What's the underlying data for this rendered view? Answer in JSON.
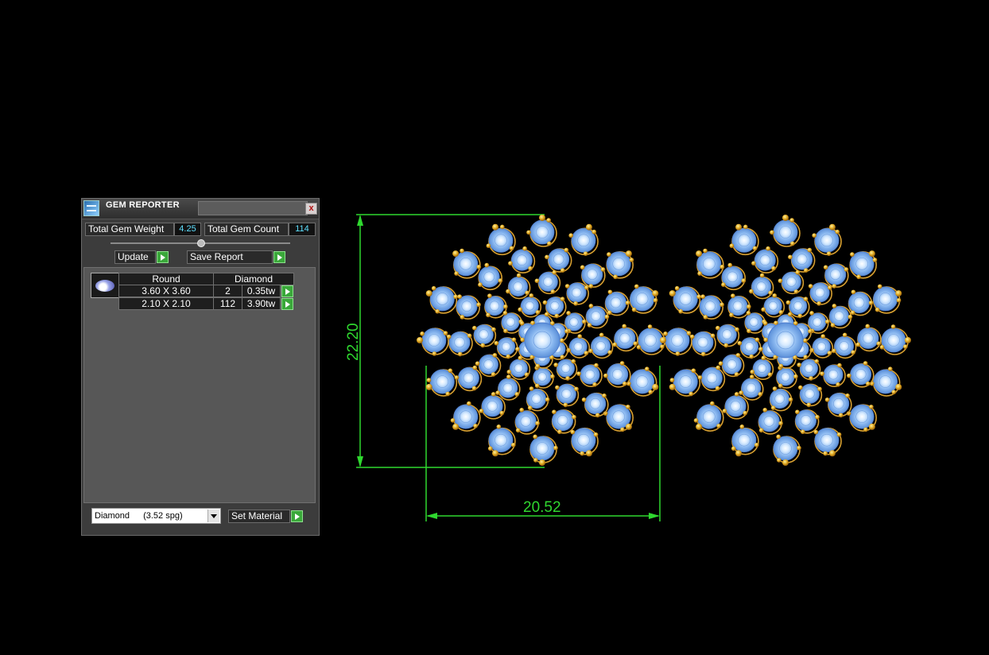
{
  "panel": {
    "title": "GEM REPORTER",
    "close_glyph": "x",
    "total_weight_label": "Total Gem Weight",
    "total_weight_value": "4.25",
    "total_count_label": "Total Gem Count",
    "total_count_value": "114",
    "update_label": "Update",
    "save_report_label": "Save Report",
    "table": {
      "shape_header": "Round",
      "material_header": "Diamond",
      "rows": [
        {
          "size": "3.60 X 3.60",
          "count": "2",
          "weight": "0.35tw"
        },
        {
          "size": "2.10 X 2.10",
          "count": "112",
          "weight": "3.90tw"
        }
      ]
    },
    "material_dropdown": {
      "name": "Diamond",
      "density": "(3.52 spg)"
    },
    "set_material_label": "Set Material"
  },
  "viewport": {
    "height_dimension": "22.20",
    "width_dimension": "20.52"
  },
  "colors": {
    "dimension_line": "#2fd82f",
    "gem_blue": "#8ab8f0",
    "prong_gold": "#e0a820",
    "value_cyan": "#5fe0ff"
  }
}
